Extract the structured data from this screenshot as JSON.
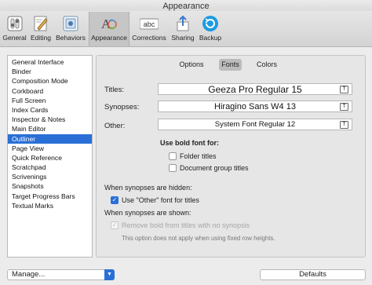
{
  "window": {
    "title": "Appearance"
  },
  "toolbar": {
    "items": [
      {
        "label": "General",
        "icon": "gear-switch-icon"
      },
      {
        "label": "Editing",
        "icon": "pencil-icon"
      },
      {
        "label": "Behaviors",
        "icon": "behaviors-icon"
      },
      {
        "label": "Appearance",
        "icon": "appearance-icon"
      },
      {
        "label": "Corrections",
        "icon": "abc-icon"
      },
      {
        "label": "Sharing",
        "icon": "share-icon"
      },
      {
        "label": "Backup",
        "icon": "backup-icon"
      }
    ],
    "active_index": 3
  },
  "sidebar": {
    "items": [
      "General Interface",
      "Binder",
      "Composition Mode",
      "Corkboard",
      "Full Screen",
      "Index Cards",
      "Inspector & Notes",
      "Main Editor",
      "Outliner",
      "Page View",
      "Quick Reference",
      "Scratchpad",
      "Scrivenings",
      "Snapshots",
      "Target Progress Bars",
      "Textual Marks"
    ],
    "selected": "Outliner"
  },
  "tabs": [
    {
      "label": "Options"
    },
    {
      "label": "Fonts"
    },
    {
      "label": "Colors"
    }
  ],
  "active_tab": "Fonts",
  "fonts": {
    "titles": {
      "label": "Titles:",
      "value": "Geeza Pro Regular 15"
    },
    "synopses": {
      "label": "Synopses:",
      "value": "Hiragino Sans W4 13"
    },
    "other": {
      "label": "Other:",
      "value": "System Font Regular 12"
    },
    "font_button_glyph": "T"
  },
  "bold": {
    "heading": "Use bold font for:",
    "folder_titles": {
      "label": "Folder titles",
      "checked": false
    },
    "group_titles": {
      "label": "Document group titles",
      "checked": false
    }
  },
  "hidden": {
    "heading": "When synopses are hidden:",
    "use_other": {
      "label": "Use \"Other\" font for titles",
      "checked": true
    }
  },
  "shown": {
    "heading": "When synopses are shown:",
    "remove_bold": {
      "label": "Remove bold from titles with no synopsis",
      "checked": true,
      "enabled": false
    },
    "note": "This option does not apply when using fixed row heights."
  },
  "footer": {
    "manage": "Manage...",
    "defaults": "Defaults"
  },
  "colors": {
    "accent": "#2a6fd6",
    "backup": "#1e9be0"
  }
}
